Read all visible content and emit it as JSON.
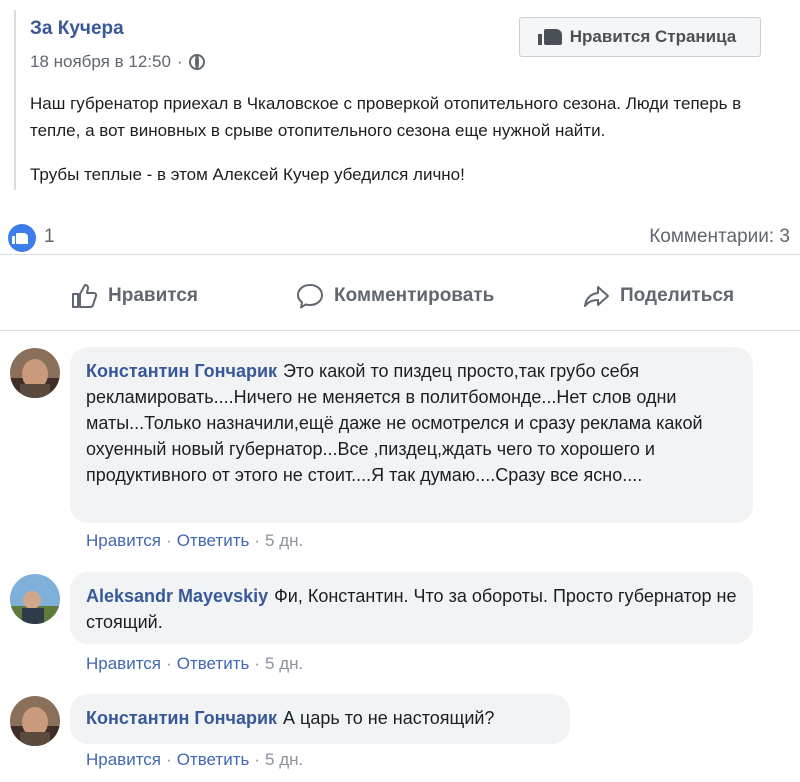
{
  "post": {
    "page_name": "За Кучера",
    "date": "18 ноября в 12:50",
    "separator": "·",
    "like_page_button": "Нравится Страница",
    "paragraphs": [
      "Наш губренатор приехал в Чкаловское с проверкой отопительного сезона. Люди теперь в тепле, а вот виновных в срыве отопительного сезона еще нужной найти.",
      "Трубы теплые - в этом Алексей Кучер убедился лично!"
    ]
  },
  "counts": {
    "likes": "1",
    "comments": "Комментарии: 3"
  },
  "actions": {
    "like": "Нравится",
    "comment": "Комментировать",
    "share": "Поделиться"
  },
  "comments": [
    {
      "author": "Константин Гончарик",
      "text": "Это какой то пиздец просто,так грубо себя рекламировать....Ничего не меняется в политбомонде...Нет слов одни маты...Только назначили,ещё даже не осмотрелся и сразу реклама какой охуенный новый губернатор...Все ,пиздец,ждать чего то хорошего и продуктивного от этого не стоит....Я так думаю....Сразу все ясно....",
      "like": "Нравится",
      "reply": "Ответить",
      "time": "5 дн."
    },
    {
      "author": "Aleksandr Mayevskiy",
      "text": "Фи, Константин. Что за обороты. Просто губернатор не стоящий.",
      "like": "Нравится",
      "reply": "Ответить",
      "time": "5 дн."
    },
    {
      "author": "Константин Гончарик",
      "text": "А царь то не настоящий?",
      "like": "Нравится",
      "reply": "Ответить",
      "time": "5 дн."
    }
  ],
  "colors": {
    "link": "#385898",
    "accent": "#3b7ded",
    "bubble": "#f2f3f5",
    "muted": "#606770"
  }
}
